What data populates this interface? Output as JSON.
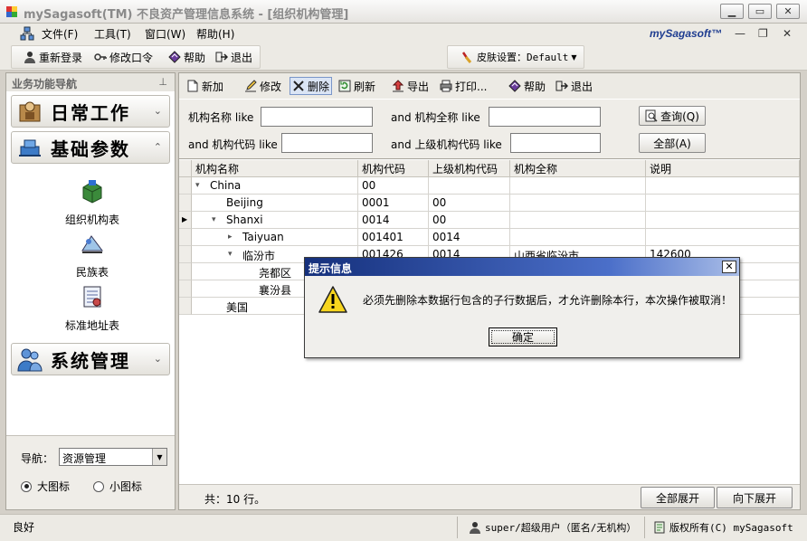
{
  "window": {
    "title": "mySagasoft(TM) 不良资产管理信息系统 - [组织机构管理]"
  },
  "menu": {
    "items": [
      "文件(F)",
      "工具(T)",
      "窗口(W)",
      "帮助(H)"
    ],
    "brand": "mySagasoft™"
  },
  "toolbar": {
    "relogin": "重新登录",
    "change_password": "修改口令",
    "help": "帮助",
    "exit": "退出",
    "skin_label": "皮肤设置：Default"
  },
  "nav": {
    "header": "业务功能导航",
    "categories": [
      "日常工作",
      "基础参数",
      "系统管理"
    ],
    "sub_items": [
      "组织机构表",
      "民族表",
      "标准地址表"
    ],
    "nav_label": "导航：",
    "nav_select": "资源管理",
    "radio_large": "大图标",
    "radio_small": "小图标"
  },
  "main_toolbar": {
    "new": "新加",
    "edit": "修改",
    "delete": "删除",
    "refresh": "刷新",
    "export": "导出",
    "print": "打印...",
    "help": "帮助",
    "exit": "退出"
  },
  "search": {
    "name_label": "机构名称 like",
    "fullname_label": "and 机构全称 like",
    "code_label": "and 机构代码 like",
    "parent_label": "and 上级机构代码 like",
    "query_button": "查询(Q)",
    "all_button": "全部(A)"
  },
  "grid": {
    "columns": [
      "机构名称",
      "机构代码",
      "上级机构代码",
      "机构全称",
      "说明"
    ],
    "rows": [
      {
        "name": "China",
        "code": "00",
        "parent": "",
        "full": "",
        "note": ""
      },
      {
        "name": "Beijing",
        "code": "0001",
        "parent": "00",
        "full": "",
        "note": ""
      },
      {
        "name": "Shanxi",
        "code": "0014",
        "parent": "00",
        "full": "",
        "note": ""
      },
      {
        "name": "Taiyuan",
        "code": "001401",
        "parent": "0014",
        "full": "",
        "note": ""
      },
      {
        "name": "临汾市",
        "code": "001426",
        "parent": "0014",
        "full": "山西省临汾市",
        "note": "142600"
      },
      {
        "name": "尧都区",
        "code": "",
        "parent": "",
        "full": "",
        "note": ""
      },
      {
        "name": "襄汾县",
        "code": "",
        "parent": "",
        "full": "",
        "note": ""
      },
      {
        "name": "美国",
        "code": "",
        "parent": "",
        "full": "",
        "note": ""
      }
    ]
  },
  "footer": {
    "count": "共：10 行。",
    "expand_all": "全部展开",
    "expand_down": "向下展开"
  },
  "status": {
    "left": "良好",
    "user": "super/超级用户（匿名/无机构）",
    "copyright": "版权所有(C) mySagasoft"
  },
  "dialog": {
    "title": "提示信息",
    "message": "必须先删除本数据行包含的子行数据后，才允许删除本行，本次操作被取消！",
    "ok": "确定"
  },
  "colors": {
    "title_blue": "#15307c",
    "brand_blue": "#1e3c90"
  }
}
